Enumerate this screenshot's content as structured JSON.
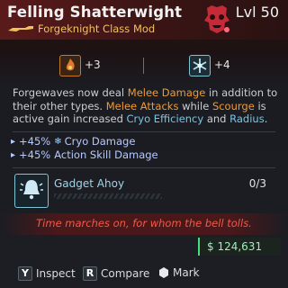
{
  "header": {
    "title": "Felling Shatterwight",
    "subtitle": "Forgeknight Class Mod",
    "level": "Lvl 50"
  },
  "class_row": {
    "left_value": "+3",
    "right_value": "+4"
  },
  "description": {
    "p1": "Forgewaves now deal ",
    "p2": "Melee Damage",
    "p3": " in addition to their other types. ",
    "p4": "Melee Attacks",
    "p5": " while ",
    "p6": "Scourge",
    "p7": " is active gain increased ",
    "p8": "Cryo Efficiency",
    "p9": " and ",
    "p10": "Radius",
    "p11": "."
  },
  "stats": [
    {
      "value": "+45%",
      "label": "Cryo Damage"
    },
    {
      "value": "+45%",
      "label": "Action Skill Damage"
    }
  ],
  "skill": {
    "name": "Gadget Ahoy",
    "count": "0/3",
    "progress": 0
  },
  "flavor_text": "Time marches on, for whom the bell tolls.",
  "price": "$ 124,631",
  "prompts": [
    {
      "key": "Y",
      "label": "Inspect"
    },
    {
      "key": "R",
      "label": "Compare"
    },
    {
      "key": "",
      "label": "Mark"
    }
  ],
  "colors": {
    "rarity_red": "#5a1a1a",
    "cryo": "#7fc3d6",
    "highlight_orange": "#f29a2e",
    "flavor_red": "#ef5a4a",
    "price_green": "#46e07a"
  },
  "icons": {
    "manufacturer": "skull-emblem-icon",
    "weapon": "weapon-silhouette-icon",
    "left_skill": "fire-skill-icon",
    "right_skill": "cryo-skill-icon",
    "gadget": "bell-gadget-icon",
    "mark": "mark-icon"
  }
}
